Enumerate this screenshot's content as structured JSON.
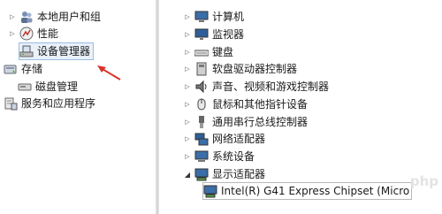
{
  "left_tree": {
    "items": [
      {
        "label": "本地用户和组",
        "icon": "users-icon"
      },
      {
        "label": "性能",
        "icon": "performance-icon"
      },
      {
        "label": "设备管理器",
        "icon": "device-manager-icon"
      },
      {
        "label": "存储",
        "icon": "storage-icon"
      },
      {
        "label": "磁盘管理",
        "icon": "disk-management-icon"
      },
      {
        "label": "服务和应用程序",
        "icon": "services-apps-icon"
      }
    ]
  },
  "device_tree": {
    "categories": [
      {
        "label": "计算机",
        "icon": "computer-icon"
      },
      {
        "label": "监视器",
        "icon": "monitor-icon"
      },
      {
        "label": "键盘",
        "icon": "keyboard-icon"
      },
      {
        "label": "软盘驱动器控制器",
        "icon": "floppy-controller-icon"
      },
      {
        "label": "声音、视频和游戏控制器",
        "icon": "sound-icon"
      },
      {
        "label": "鼠标和其他指针设备",
        "icon": "mouse-icon"
      },
      {
        "label": "通用串行总线控制器",
        "icon": "usb-icon"
      },
      {
        "label": "网络适配器",
        "icon": "network-adapter-icon"
      },
      {
        "label": "系统设备",
        "icon": "system-devices-icon"
      },
      {
        "label": "显示适配器",
        "icon": "display-adapter-icon"
      }
    ],
    "display_adapter_child": {
      "label": "Intel(R) G41 Express Chipset (Micro",
      "icon": "display-adapter-icon"
    }
  },
  "watermark": "php",
  "colors": {
    "annotation_arrow": "#d9342b",
    "selection_outline": "#9bbbe3"
  }
}
